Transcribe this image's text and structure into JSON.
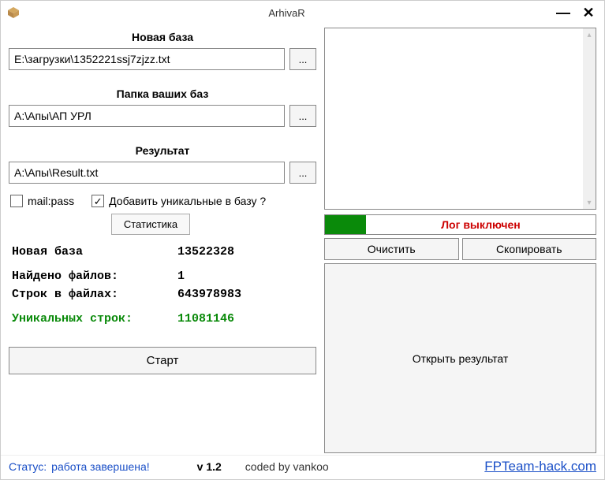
{
  "window": {
    "title": "ArhivaR"
  },
  "sections": {
    "newBase": {
      "label": "Новая база",
      "path": "E:\\загрузки\\1352221ssj7zjzz.txt",
      "browse": "..."
    },
    "baseFolder": {
      "label": "Папка ваших баз",
      "path": "A:\\Апы\\АП УРЛ",
      "browse": "..."
    },
    "result": {
      "label": "Результат",
      "path": "A:\\Апы\\Result.txt",
      "browse": "..."
    }
  },
  "options": {
    "mailpass": {
      "label": "mail:pass",
      "checked": false
    },
    "addUnique": {
      "label": "Добавить уникальные в базу ?",
      "checked": true
    },
    "statsBtn": "Статистика"
  },
  "stats": {
    "newBase": {
      "label": "Новая база",
      "value": "13522328"
    },
    "filesFound": {
      "label": "Найдено файлов:",
      "value": "1"
    },
    "linesInFiles": {
      "label": "Строк в файлах:",
      "value": "643978983"
    },
    "uniqueLines": {
      "label": "Уникальных строк:",
      "value": "11081146"
    }
  },
  "buttons": {
    "start": "Старт",
    "logOff": "Лог выключен",
    "clear": "Очистить",
    "copy": "Скопировать",
    "openResult": "Открыть результат"
  },
  "footer": {
    "statusLabel": "Статус:",
    "statusValue": "работа завершена!",
    "version": "v 1.2",
    "coded": "coded by vankoo",
    "site": "FPTeam-hack.com"
  }
}
